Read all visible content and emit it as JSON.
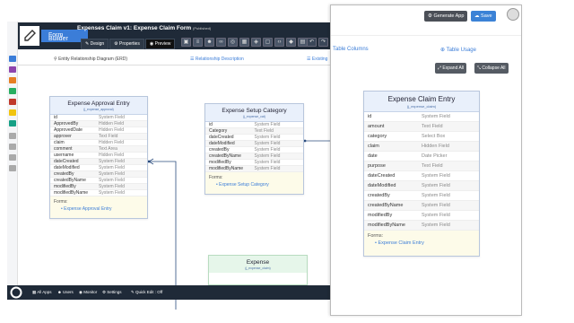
{
  "topbar": {
    "app_title": "Form Builder",
    "form_title": "Expenses Claim v1: Expense Claim Form",
    "form_state": "(Published)",
    "tabs": [
      {
        "label": "Design",
        "icon": "pencil-icon"
      },
      {
        "label": "Properties",
        "icon": "gear-icon"
      },
      {
        "label": "Preview",
        "icon": "eye-icon"
      }
    ],
    "toolbar_icons": [
      "lock-icon",
      "stack-icon",
      "users-icon",
      "link-icon",
      "eye-icon",
      "grid-icon",
      "share-icon",
      "image-icon",
      "code-icon",
      "shield-icon",
      "database-icon"
    ],
    "undo_redo": [
      "undo-icon",
      "redo-icon",
      "expand-icon"
    ]
  },
  "subtabs": {
    "erd": "Entity Relationship Diagram (ERD)",
    "relationship": "Relationship Description",
    "existing": "Existing"
  },
  "cards": [
    {
      "title": "Expense Approval Entry",
      "subtitle": "(j_expense_approval)",
      "rows": [
        {
          "name": "id",
          "type": "System Field"
        },
        {
          "name": "ApprovedBy",
          "type": "Hidden Field"
        },
        {
          "name": "ApprovedDate",
          "type": "Hidden Field"
        },
        {
          "name": "approver",
          "type": "Text Field"
        },
        {
          "name": "claim",
          "type": "Hidden Field"
        },
        {
          "name": "comment",
          "type": "Text Area"
        },
        {
          "name": "username",
          "type": "Hidden Field"
        },
        {
          "name": "dateCreated",
          "type": "System Field"
        },
        {
          "name": "dateModified",
          "type": "System Field"
        },
        {
          "name": "createdBy",
          "type": "System Field"
        },
        {
          "name": "createdByName",
          "type": "System Field"
        },
        {
          "name": "modifiedBy",
          "type": "System Field"
        },
        {
          "name": "modifiedByName",
          "type": "System Field"
        }
      ],
      "forms_label": "Forms:",
      "forms": [
        "Expense Approval Entry"
      ]
    },
    {
      "title": "Expense Setup Category",
      "subtitle": "(j_expense_cat)",
      "rows": [
        {
          "name": "id",
          "type": "System Field"
        },
        {
          "name": "Category",
          "type": "Text Field"
        },
        {
          "name": "dateCreated",
          "type": "System Field"
        },
        {
          "name": "dateModified",
          "type": "System Field"
        },
        {
          "name": "createdBy",
          "type": "System Field"
        },
        {
          "name": "createdByName",
          "type": "System Field"
        },
        {
          "name": "modifiedBy",
          "type": "System Field"
        },
        {
          "name": "modifiedByName",
          "type": "System Field"
        }
      ],
      "forms_label": "Forms:",
      "forms": [
        "Expense Setup Category"
      ]
    }
  ],
  "partial_card": {
    "title": "Expense",
    "subtitle": "(j_expense_claim)"
  },
  "bottombar": {
    "all_apps": "All Apps",
    "users": "Users",
    "monitor": "Monitor",
    "settings": "Settings",
    "quick_edit": "Quick Edit : Off"
  },
  "panel": {
    "generate_label": "Generate App",
    "save_label": "Save",
    "table_columns": "Table Columns",
    "table_usage": "Table Usage",
    "expand_all": "Expand All",
    "collapse_all": "Collapse All",
    "card": {
      "title": "Expense Claim Entry",
      "subtitle": "(j_expense_claim)",
      "rows": [
        {
          "name": "id",
          "type": "System Field"
        },
        {
          "name": "amount",
          "type": "Text Field"
        },
        {
          "name": "category",
          "type": "Select Box"
        },
        {
          "name": "claim",
          "type": "Hidden Field"
        },
        {
          "name": "date",
          "type": "Date Picker"
        },
        {
          "name": "purpose",
          "type": "Text Field"
        },
        {
          "name": "dateCreated",
          "type": "System Field"
        },
        {
          "name": "dateModified",
          "type": "System Field"
        },
        {
          "name": "createdBy",
          "type": "System Field"
        },
        {
          "name": "createdByName",
          "type": "System Field"
        },
        {
          "name": "modifiedBy",
          "type": "System Field"
        },
        {
          "name": "modifiedByName",
          "type": "System Field"
        }
      ],
      "forms_label": "Forms:",
      "forms": [
        "Expense Claim Entry"
      ]
    }
  },
  "colors": {
    "topbar": "#1f2a38",
    "accent": "#3b7dd8",
    "card_header": "#e9f0fb",
    "forms_bg": "#fdfbe9"
  }
}
